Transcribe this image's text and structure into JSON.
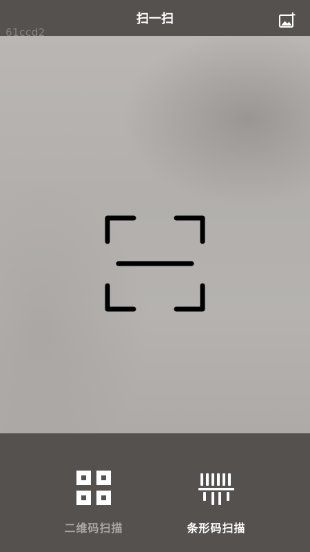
{
  "header": {
    "title": "扫一扫",
    "watermark": "61ccd2",
    "album_icon": "image-add-icon"
  },
  "scanner": {
    "frame_icon": "scan-frame-icon"
  },
  "modes": [
    {
      "label": "二维码扫描",
      "icon": "qr-code-icon",
      "active": false
    },
    {
      "label": "条形码扫描",
      "icon": "barcode-icon",
      "active": true
    }
  ],
  "colors": {
    "bar_background": "#55514f",
    "camera_background": "#b4b1ae",
    "active_label": "#ffffff",
    "inactive_label": "#a9a6a4"
  }
}
